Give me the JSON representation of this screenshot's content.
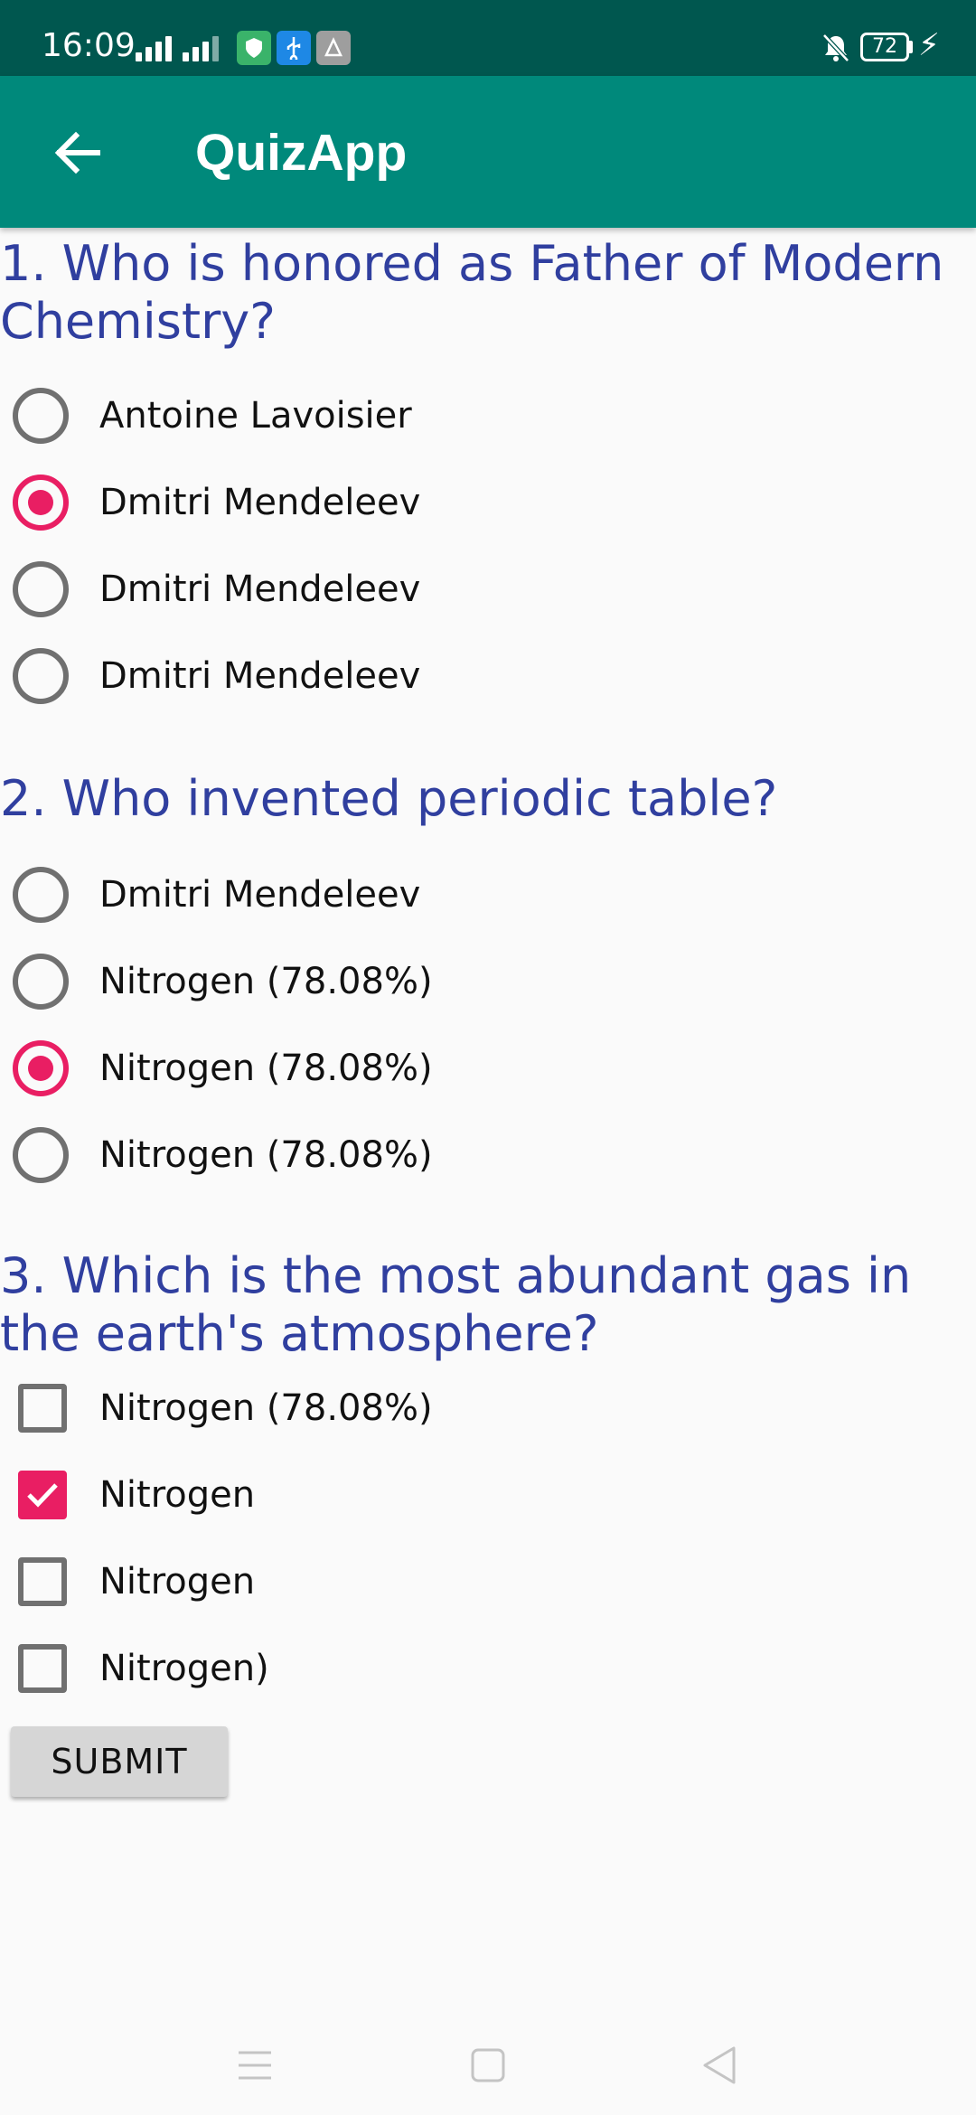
{
  "status_bar": {
    "time": "16:09",
    "battery": "72"
  },
  "app_bar": {
    "title": "QuizApp"
  },
  "colors": {
    "status_bar": "#00574f",
    "app_bar": "#00897b",
    "question_text": "#303f9f",
    "accent": "#e91e63",
    "unchecked": "#707070",
    "background": "#fafafa"
  },
  "questions": [
    {
      "text": "1. Who is honored as Father of Modern Chemistry?",
      "type": "radio",
      "options": [
        {
          "label": "Antoine Lavoisier",
          "checked": false
        },
        {
          "label": "Dmitri Mendeleev",
          "checked": true
        },
        {
          "label": "Dmitri Mendeleev",
          "checked": false
        },
        {
          "label": "Dmitri Mendeleev",
          "checked": false
        }
      ]
    },
    {
      "text": "2. Who invented periodic table?",
      "type": "radio",
      "options": [
        {
          "label": "Dmitri Mendeleev",
          "checked": false
        },
        {
          "label": "Nitrogen (78.08%)",
          "checked": false
        },
        {
          "label": "Nitrogen (78.08%)",
          "checked": true
        },
        {
          "label": "Nitrogen (78.08%)",
          "checked": false
        }
      ]
    },
    {
      "text": "3. Which is the most abundant gas in the earth's atmosphere?",
      "type": "checkbox",
      "options": [
        {
          "label": "Nitrogen (78.08%)",
          "checked": false
        },
        {
          "label": "Nitrogen",
          "checked": true
        },
        {
          "label": "Nitrogen",
          "checked": false
        },
        {
          "label": "Nitrogen)",
          "checked": false
        }
      ]
    }
  ],
  "submit_label": "SUBMIT",
  "icons": {
    "back": "arrow-left-icon",
    "nav_menu": "menu-icon",
    "nav_home": "home-square-icon",
    "nav_back": "back-triangle-icon"
  }
}
